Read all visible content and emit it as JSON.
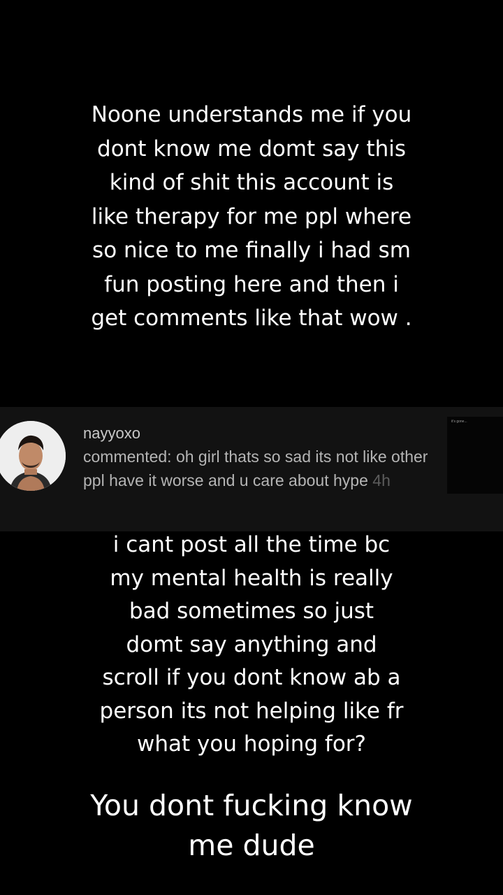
{
  "captions": {
    "top": "Noone understands me if you dont know me domt say this kind of shit this account is like therapy for me ppl where so nice to me finally i had sm fun posting here and then i get comments like that wow .",
    "middle": "i cant post all the time bc my mental health is really bad sometimes so just domt say anything and scroll if you dont know ab a person its not helping like fr what you hoping for?",
    "bottom": "You dont fucking know me dude"
  },
  "comment": {
    "username": "nayyoxo",
    "text": "commented: oh girl thats so sad its not like other ppl have it worse and u care about hype",
    "time": "4h",
    "avatar_icon": "profile-avatar",
    "thumbnail_label": "it's gone..."
  },
  "colors": {
    "background": "#000000",
    "card": "#121212",
    "text": "#ffffff",
    "comment_text": "#b5b5b5",
    "timestamp": "#5c5c5c"
  }
}
